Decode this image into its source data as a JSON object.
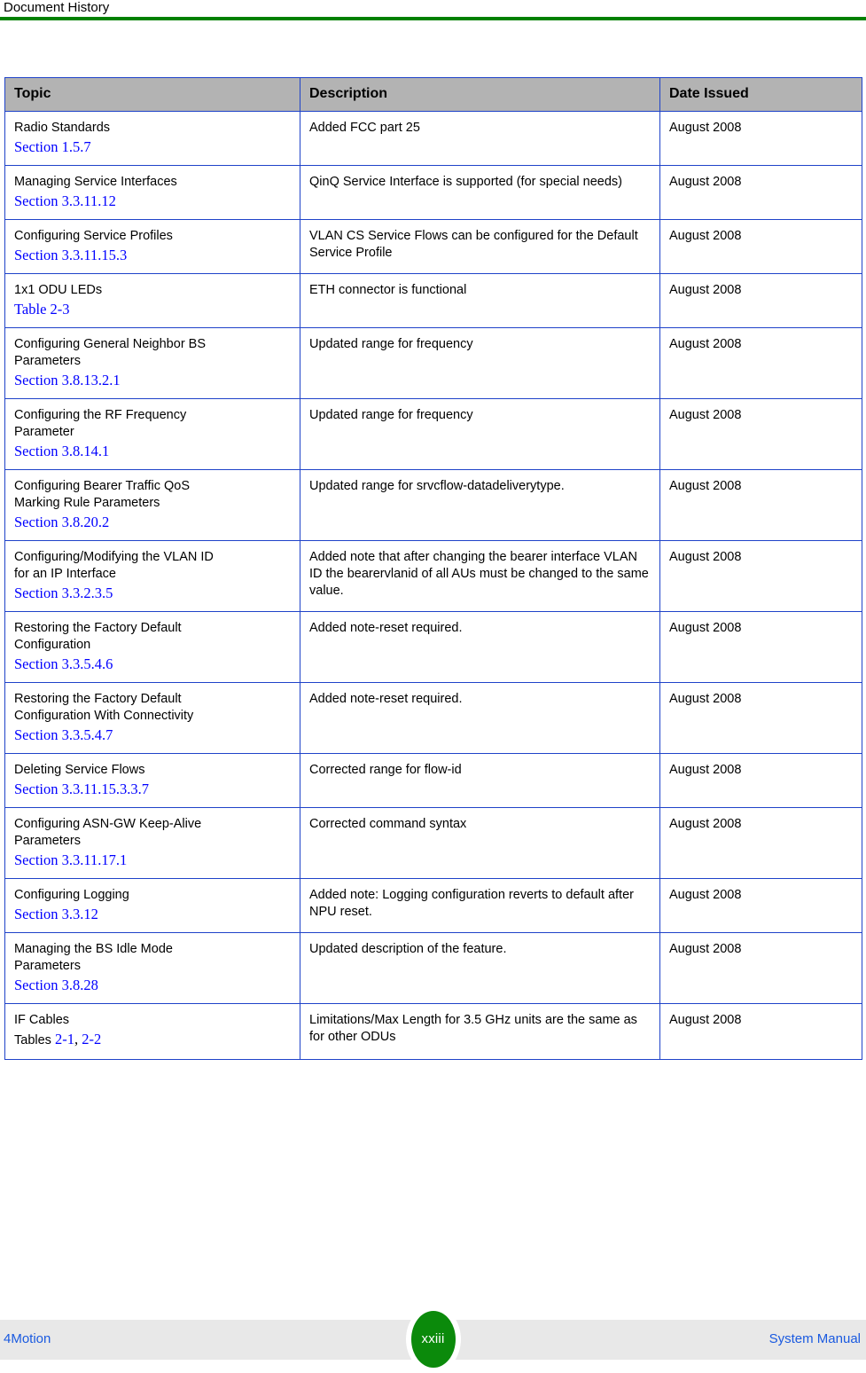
{
  "header": {
    "title": "Document History",
    "rule_color": "#008000"
  },
  "table": {
    "header_bg": "#b3b3b3",
    "border_color": "#1f43c9",
    "link_color": "#0000ff",
    "columns": [
      "Topic",
      "Description",
      "Date Issued"
    ],
    "rows": [
      {
        "topic_lines": [
          "Radio Standards"
        ],
        "xref_prefix": "",
        "xrefs": [
          "Section 1.5.7"
        ],
        "description": "Added FCC part 25",
        "date": "August 2008"
      },
      {
        "topic_lines": [
          "Managing Service Interfaces"
        ],
        "xref_prefix": "",
        "xrefs": [
          "Section 3.3.11.12"
        ],
        "description": "QinQ Service Interface is supported (for special needs)",
        "date": "August 2008"
      },
      {
        "topic_lines": [
          "Configuring Service Profiles"
        ],
        "xref_prefix": "",
        "xrefs": [
          "Section 3.3.11.15.3"
        ],
        "description": "VLAN CS Service Flows can be configured for the Default Service Profile",
        "date": "August 2008"
      },
      {
        "topic_lines": [
          "1x1 ODU LEDs"
        ],
        "xref_prefix": "",
        "xrefs": [
          "Table 2-3"
        ],
        "description": "ETH connector is functional",
        "date": "August 2008"
      },
      {
        "topic_lines": [
          "Configuring General Neighbor BS",
          "Parameters"
        ],
        "xref_prefix": "",
        "xrefs": [
          "Section 3.8.13.2.1"
        ],
        "description": "Updated range for frequency",
        "date": "August 2008"
      },
      {
        "topic_lines": [
          "Configuring the RF Frequency",
          "Parameter"
        ],
        "xref_prefix": "",
        "xrefs": [
          "Section 3.8.14.1"
        ],
        "description": "Updated range for frequency",
        "date": "August 2008"
      },
      {
        "topic_lines": [
          "Configuring Bearer Traffic QoS",
          "Marking Rule Parameters"
        ],
        "xref_prefix": "",
        "xrefs": [
          "Section 3.8.20.2"
        ],
        "description": "Updated range for srvcflow-datadeliverytype.",
        "date": "August 2008"
      },
      {
        "topic_lines": [
          "Configuring/Modifying the VLAN ID",
          "for an IP Interface"
        ],
        "xref_prefix": "",
        "xrefs": [
          "Section 3.3.2.3.5"
        ],
        "description": "Added note that after changing the bearer interface VLAN ID the bearervlanid of all AUs must be changed to the same value.",
        "date": "August 2008"
      },
      {
        "topic_lines": [
          "Restoring the Factory Default",
          "Configuration"
        ],
        "xref_prefix": "",
        "xrefs": [
          "Section 3.3.5.4.6"
        ],
        "description": "Added note-reset required.",
        "date": "August 2008"
      },
      {
        "topic_lines": [
          "Restoring the Factory Default",
          "Configuration With Connectivity"
        ],
        "xref_prefix": "",
        "xrefs": [
          "Section 3.3.5.4.7"
        ],
        "description": "Added note-reset required.",
        "date": "August 2008"
      },
      {
        "topic_lines": [
          "Deleting Service Flows"
        ],
        "xref_prefix": "",
        "xrefs": [
          "Section 3.3.11.15.3.3.7"
        ],
        "description": "Corrected range for flow-id",
        "date": "August 2008"
      },
      {
        "topic_lines": [
          "Configuring ASN-GW Keep-Alive",
          "Parameters"
        ],
        "xref_prefix": "",
        "xrefs": [
          "Section 3.3.11.17.1"
        ],
        "description": "Corrected command syntax",
        "date": "August 2008"
      },
      {
        "topic_lines": [
          "Configuring Logging"
        ],
        "xref_prefix": "",
        "xrefs": [
          "Section 3.3.12"
        ],
        "description": "Added note: Logging configuration reverts to default after NPU reset.",
        "date": "August 2008"
      },
      {
        "topic_lines": [
          "Managing the BS Idle Mode",
          "Parameters"
        ],
        "xref_prefix": "",
        "xrefs": [
          "Section 3.8.28"
        ],
        "description": "Updated description of the feature.",
        "date": "August 2008"
      },
      {
        "topic_lines": [
          "IF Cables"
        ],
        "xref_prefix": "Tables ",
        "xrefs": [
          "2-1",
          "2-2"
        ],
        "description": "Limitations/Max Length for 3.5 GHz units are the same as for other ODUs",
        "date": "August 2008"
      }
    ]
  },
  "footer": {
    "left_label": "4Motion",
    "page_number": "xxiii",
    "right_label": "System Manual",
    "badge_color": "#0b8a0b",
    "band_color": "#e8e8e8",
    "link_color": "#1a5ae0"
  }
}
